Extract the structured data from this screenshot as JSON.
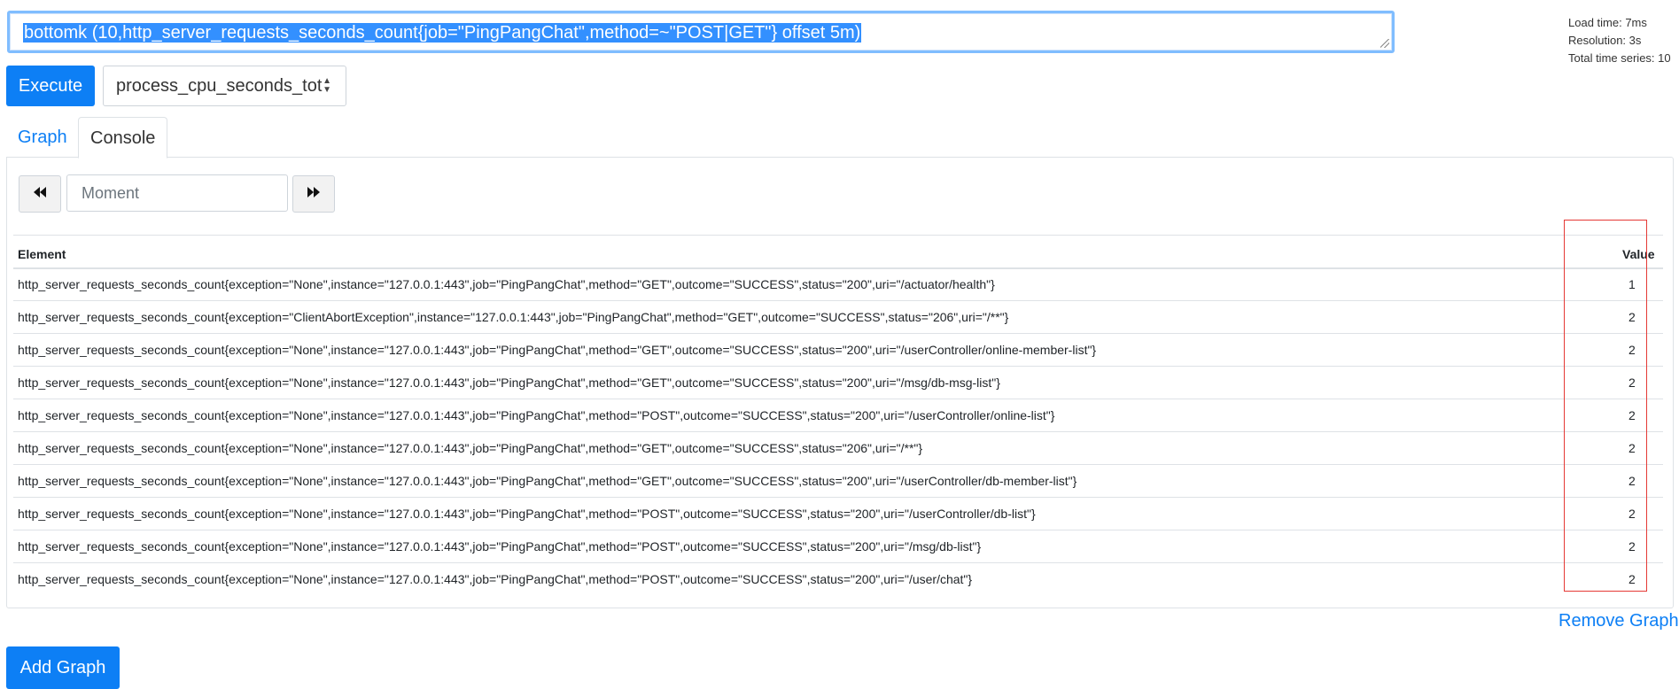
{
  "query": {
    "text": "bottomk (10,http_server_requests_seconds_count{job=\"PingPangChat\",method=~\"POST|GET\"} offset 5m)"
  },
  "stats": {
    "load_time": "Load time: 7ms",
    "resolution": "Resolution: 3s",
    "total_series": "Total time series: 10"
  },
  "toolbar": {
    "execute_label": "Execute",
    "metric_select_value": "process_cpu_seconds_tot"
  },
  "tabs": [
    {
      "label": "Graph",
      "active": false
    },
    {
      "label": "Console",
      "active": true
    }
  ],
  "console": {
    "moment_placeholder": "Moment",
    "prev_icon": "fast-backward-icon",
    "next_icon": "fast-forward-icon"
  },
  "table": {
    "headers": [
      "Element",
      "Value"
    ],
    "rows": [
      {
        "element": "http_server_requests_seconds_count{exception=\"None\",instance=\"127.0.0.1:443\",job=\"PingPangChat\",method=\"GET\",outcome=\"SUCCESS\",status=\"200\",uri=\"/actuator/health\"}",
        "value": "1"
      },
      {
        "element": "http_server_requests_seconds_count{exception=\"ClientAbortException\",instance=\"127.0.0.1:443\",job=\"PingPangChat\",method=\"GET\",outcome=\"SUCCESS\",status=\"206\",uri=\"/**\"}",
        "value": "2"
      },
      {
        "element": "http_server_requests_seconds_count{exception=\"None\",instance=\"127.0.0.1:443\",job=\"PingPangChat\",method=\"GET\",outcome=\"SUCCESS\",status=\"200\",uri=\"/userController/online-member-list\"}",
        "value": "2"
      },
      {
        "element": "http_server_requests_seconds_count{exception=\"None\",instance=\"127.0.0.1:443\",job=\"PingPangChat\",method=\"GET\",outcome=\"SUCCESS\",status=\"200\",uri=\"/msg/db-msg-list\"}",
        "value": "2"
      },
      {
        "element": "http_server_requests_seconds_count{exception=\"None\",instance=\"127.0.0.1:443\",job=\"PingPangChat\",method=\"POST\",outcome=\"SUCCESS\",status=\"200\",uri=\"/userController/online-list\"}",
        "value": "2"
      },
      {
        "element": "http_server_requests_seconds_count{exception=\"None\",instance=\"127.0.0.1:443\",job=\"PingPangChat\",method=\"GET\",outcome=\"SUCCESS\",status=\"206\",uri=\"/**\"}",
        "value": "2"
      },
      {
        "element": "http_server_requests_seconds_count{exception=\"None\",instance=\"127.0.0.1:443\",job=\"PingPangChat\",method=\"GET\",outcome=\"SUCCESS\",status=\"200\",uri=\"/userController/db-member-list\"}",
        "value": "2"
      },
      {
        "element": "http_server_requests_seconds_count{exception=\"None\",instance=\"127.0.0.1:443\",job=\"PingPangChat\",method=\"POST\",outcome=\"SUCCESS\",status=\"200\",uri=\"/userController/db-list\"}",
        "value": "2"
      },
      {
        "element": "http_server_requests_seconds_count{exception=\"None\",instance=\"127.0.0.1:443\",job=\"PingPangChat\",method=\"POST\",outcome=\"SUCCESS\",status=\"200\",uri=\"/msg/db-list\"}",
        "value": "2"
      },
      {
        "element": "http_server_requests_seconds_count{exception=\"None\",instance=\"127.0.0.1:443\",job=\"PingPangChat\",method=\"POST\",outcome=\"SUCCESS\",status=\"200\",uri=\"/user/chat\"}",
        "value": "2"
      }
    ]
  },
  "footer": {
    "remove_graph_label": "Remove Graph",
    "add_graph_label": "Add Graph"
  },
  "colors": {
    "primary": "#0d7ff5",
    "selection": "#3390ff",
    "annotation_box": "#e53935"
  }
}
